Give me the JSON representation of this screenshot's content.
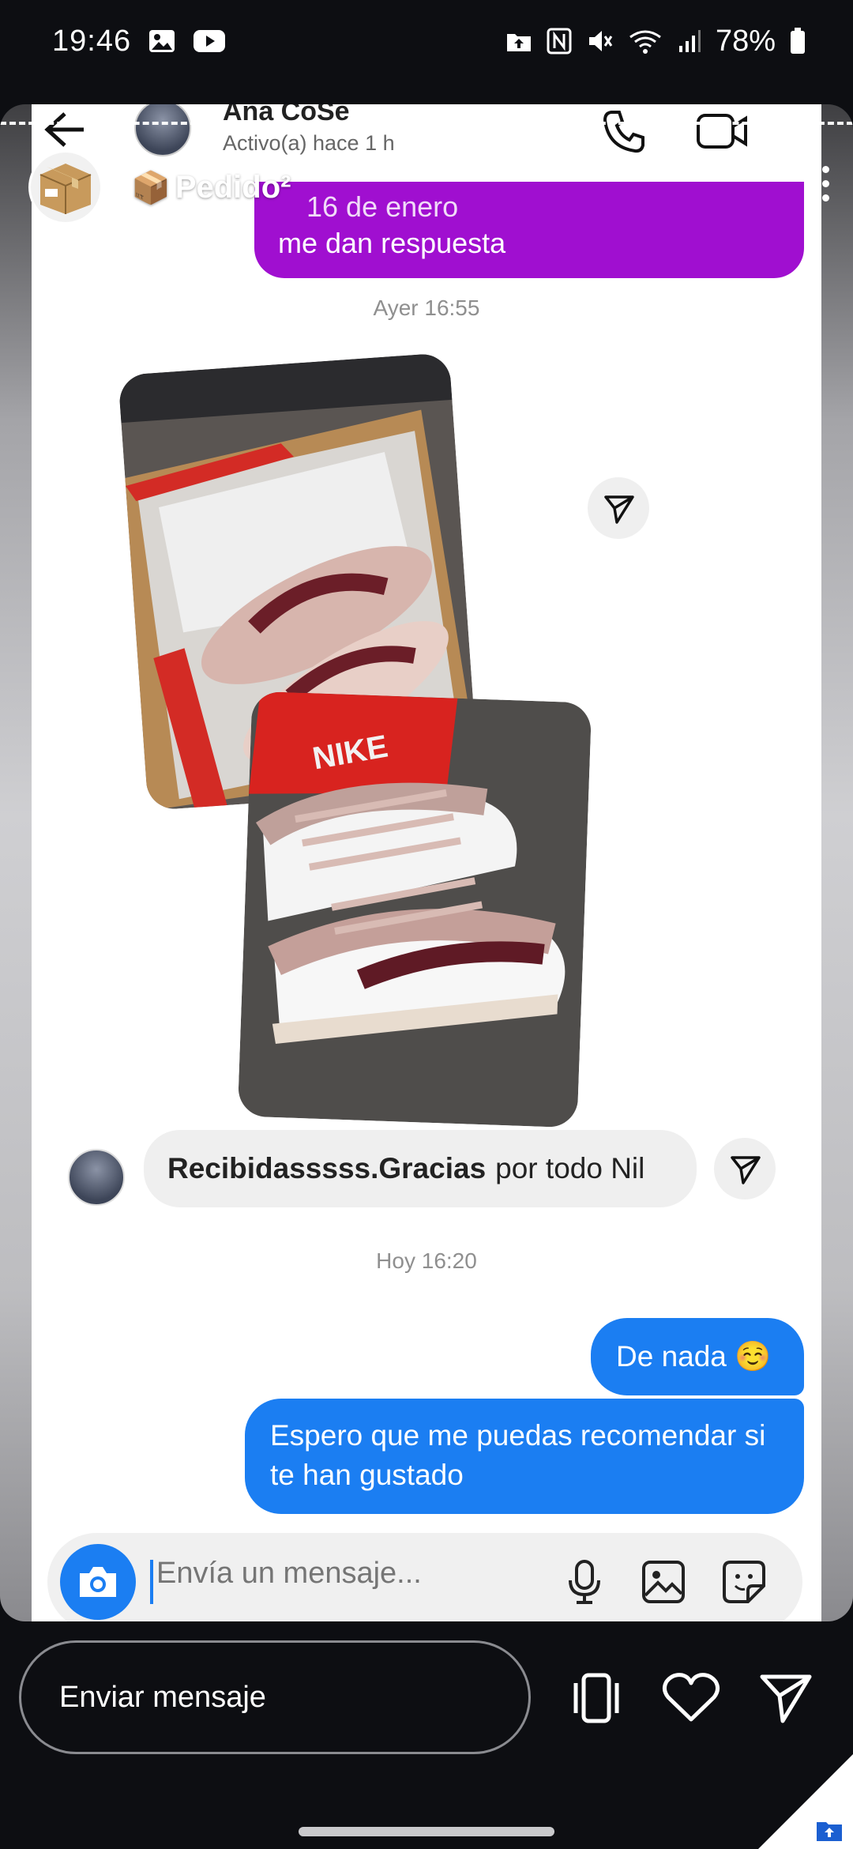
{
  "status_bar": {
    "time": "19:46",
    "battery": "78%",
    "icons": [
      "gallery-icon",
      "youtube-icon",
      "upload-icon",
      "nfc-icon",
      "mute-icon",
      "wifi-icon",
      "signal-icon",
      "battery-icon"
    ]
  },
  "dm_header": {
    "name": "Ana CoSe",
    "active": "Activo(a) hace 1 h"
  },
  "story": {
    "user": "Pedido²",
    "user_emoji": "📦",
    "overlap_text": "16 de enero"
  },
  "messages": {
    "purple_text": "me dan respuesta",
    "timestamp_1": "Ayer 16:55",
    "received_bold": "Recibidasssss.Gracias",
    "received_rest": "por todo Nil",
    "timestamp_2": "Hoy 16:20",
    "sent_1": "De nada ☺️",
    "sent_2": "Espero que me puedas recomendar si te han gustado"
  },
  "composer": {
    "placeholder": "Envía un mensaje..."
  },
  "reply_bar": {
    "placeholder": "Enviar mensaje"
  },
  "colors": {
    "purple_bubble": "#a00fd0",
    "blue_bubble": "#1b7ef2",
    "gray_bubble": "#efefef",
    "background": "#0d0e12"
  }
}
